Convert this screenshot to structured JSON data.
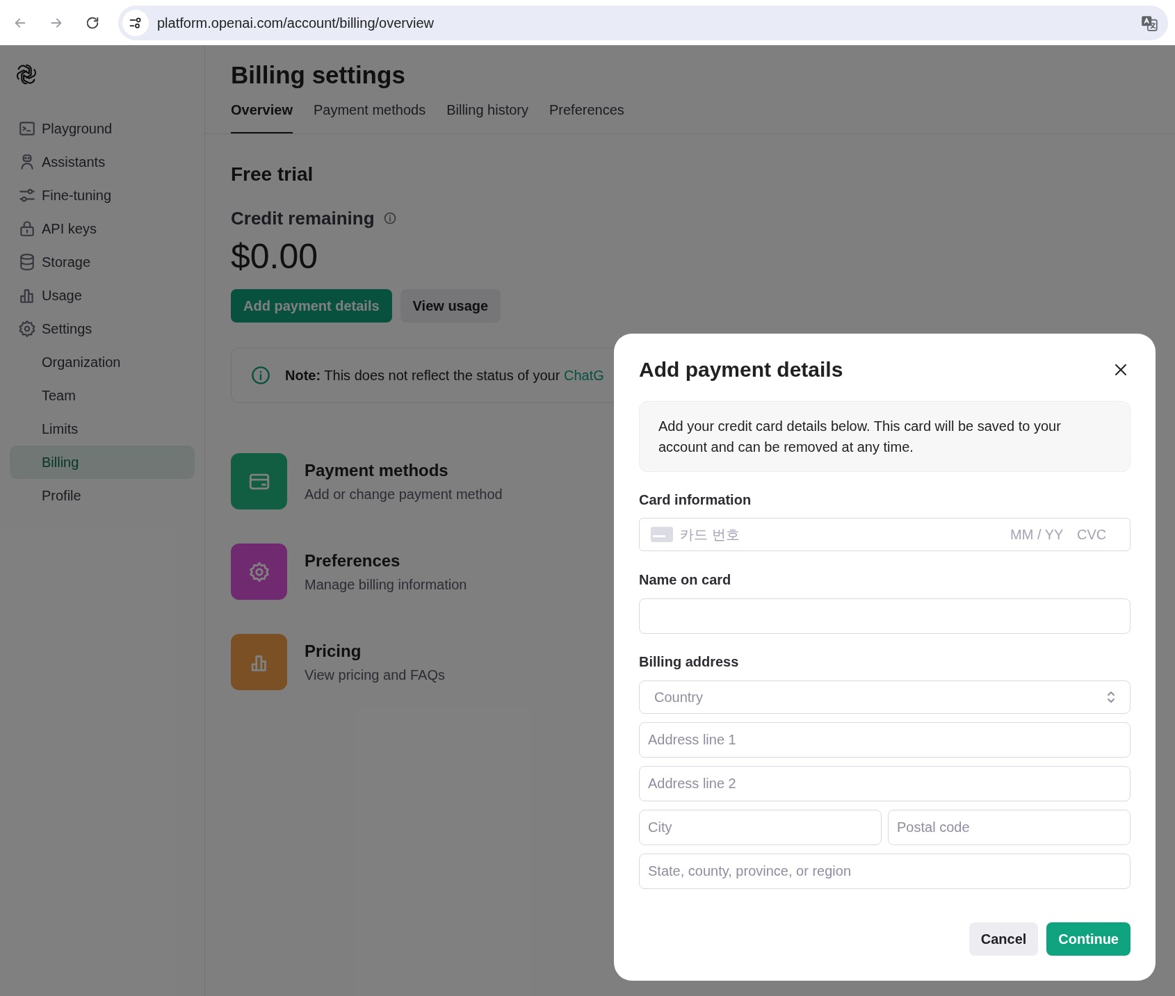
{
  "browser": {
    "url": "platform.openai.com/account/billing/overview"
  },
  "sidebar": {
    "items": [
      {
        "label": "Playground",
        "kind": "main",
        "selected": false
      },
      {
        "label": "Assistants",
        "kind": "main",
        "selected": false
      },
      {
        "label": "Fine-tuning",
        "kind": "main",
        "selected": false
      },
      {
        "label": "API keys",
        "kind": "main",
        "selected": false
      },
      {
        "label": "Storage",
        "kind": "main",
        "selected": false
      },
      {
        "label": "Usage",
        "kind": "main",
        "selected": false
      },
      {
        "label": "Settings",
        "kind": "main",
        "selected": false
      },
      {
        "label": "Organization",
        "kind": "sub",
        "selected": false
      },
      {
        "label": "Team",
        "kind": "sub",
        "selected": false
      },
      {
        "label": "Limits",
        "kind": "sub",
        "selected": false
      },
      {
        "label": "Billing",
        "kind": "sub",
        "selected": true
      },
      {
        "label": "Profile",
        "kind": "sub",
        "selected": false
      }
    ]
  },
  "page": {
    "title": "Billing settings",
    "tabs": [
      {
        "label": "Overview",
        "selected": true
      },
      {
        "label": "Payment methods",
        "selected": false
      },
      {
        "label": "Billing history",
        "selected": false
      },
      {
        "label": "Preferences",
        "selected": false
      }
    ],
    "plan": "Free trial",
    "credit_label": "Credit remaining",
    "credit_amount": "$0.00",
    "buttons": [
      {
        "label": "Add payment details",
        "kind": "primary"
      },
      {
        "label": "View usage",
        "kind": "secondary"
      }
    ],
    "note": {
      "label": "Note:",
      "text": "This does not reflect the status of your",
      "link": "ChatG"
    },
    "cards": [
      {
        "title": "Payment methods",
        "subtitle": "Add or change payment method",
        "color": "#125e42"
      },
      {
        "title": "Preferences",
        "subtitle": "Manage billing information",
        "color": "#6f2a70"
      },
      {
        "title": "Pricing",
        "subtitle": "View pricing and FAQs",
        "color": "#7a5024"
      }
    ]
  },
  "dialog": {
    "title": "Add payment details",
    "intro": "Add your credit card details below. This card will be saved to your account and can be removed at any time.",
    "card_label": "Card information",
    "card_number_placeholder": "카드 번호",
    "expiry_placeholder": "MM / YY",
    "cvc_placeholder": "CVC",
    "name_label": "Name on card",
    "address_label": "Billing address",
    "country_placeholder": "Country",
    "address_fields": [
      {
        "placeholder": "Address line 1"
      },
      {
        "placeholder": "Address line 2"
      }
    ],
    "city_placeholder": "City",
    "postal_placeholder": "Postal code",
    "region_placeholder": "State, county, province, or region",
    "actions": [
      {
        "label": "Cancel",
        "kind": "secondary"
      },
      {
        "label": "Continue",
        "kind": "primary"
      }
    ]
  }
}
